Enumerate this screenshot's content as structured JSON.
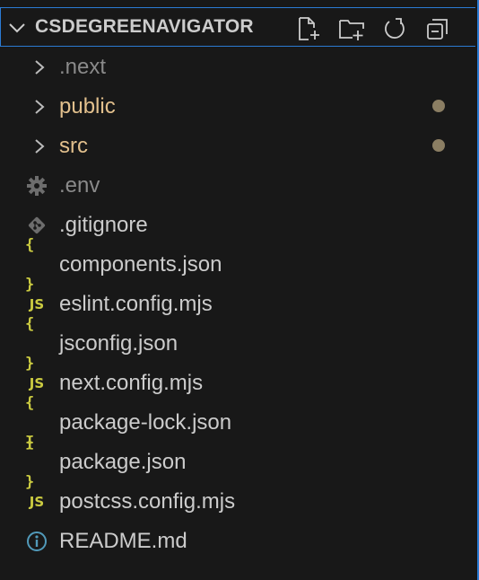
{
  "explorer": {
    "title": "CSDEGREENAVIGATOR",
    "actions": [
      {
        "name": "new-file",
        "icon": "new-file-icon"
      },
      {
        "name": "new-folder",
        "icon": "new-folder-icon"
      },
      {
        "name": "refresh",
        "icon": "refresh-icon"
      },
      {
        "name": "collapse-all",
        "icon": "collapse-all-icon"
      }
    ],
    "items": [
      {
        "label": ".next",
        "type": "folder",
        "expanded": false,
        "dimmed": true,
        "color": "#8a8a8a"
      },
      {
        "label": "public",
        "type": "folder",
        "expanded": false,
        "modified": true,
        "color": "#e2c08d"
      },
      {
        "label": "src",
        "type": "folder",
        "expanded": false,
        "modified": true,
        "color": "#e2c08d"
      },
      {
        "label": ".env",
        "type": "file",
        "icon": "gear-icon",
        "dimmed": true,
        "color": "#8a8a8a"
      },
      {
        "label": ".gitignore",
        "type": "file",
        "icon": "git-icon",
        "color": "#cccccc"
      },
      {
        "label": "components.json",
        "type": "file",
        "icon": "json-icon",
        "color": "#cccccc"
      },
      {
        "label": "eslint.config.mjs",
        "type": "file",
        "icon": "js-icon",
        "color": "#cccccc"
      },
      {
        "label": "jsconfig.json",
        "type": "file",
        "icon": "json-icon",
        "color": "#cccccc"
      },
      {
        "label": "next.config.mjs",
        "type": "file",
        "icon": "js-icon",
        "color": "#cccccc"
      },
      {
        "label": "package-lock.json",
        "type": "file",
        "icon": "json-icon",
        "color": "#cccccc"
      },
      {
        "label": "package.json",
        "type": "file",
        "icon": "json-icon",
        "color": "#cccccc"
      },
      {
        "label": "postcss.config.mjs",
        "type": "file",
        "icon": "js-icon",
        "color": "#cccccc"
      },
      {
        "label": "README.md",
        "type": "file",
        "icon": "info-icon",
        "color": "#cccccc"
      }
    ],
    "icon_glyphs": {
      "json": "{ }",
      "js": "JS"
    },
    "colors": {
      "accent": "#2b7bd3",
      "modified_dot": "#8b7e63",
      "icon_yellow": "#cbcb41",
      "info_blue": "#519aba"
    }
  }
}
